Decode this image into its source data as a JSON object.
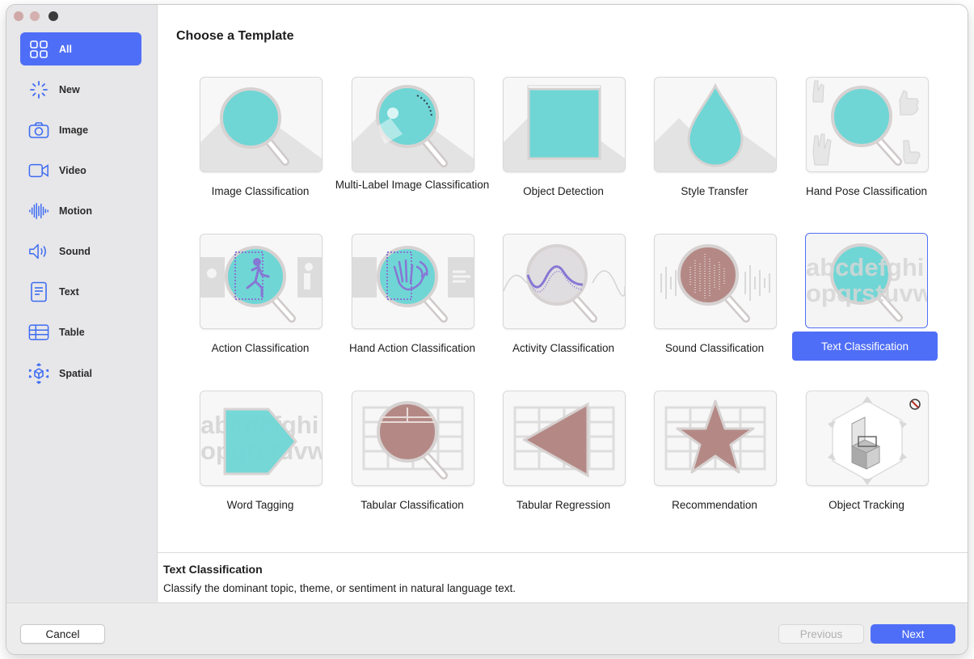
{
  "sidebar": {
    "items": [
      {
        "label": "All",
        "icon": "grid-icon",
        "active": true
      },
      {
        "label": "New",
        "icon": "sparkle-icon"
      },
      {
        "label": "Image",
        "icon": "camera-icon"
      },
      {
        "label": "Video",
        "icon": "video-camera-icon"
      },
      {
        "label": "Motion",
        "icon": "waveform-icon"
      },
      {
        "label": "Sound",
        "icon": "speaker-icon"
      },
      {
        "label": "Text",
        "icon": "document-icon"
      },
      {
        "label": "Table",
        "icon": "table-icon"
      },
      {
        "label": "Spatial",
        "icon": "spatial-cube-icon"
      }
    ]
  },
  "main": {
    "heading": "Choose a Template",
    "templates": [
      {
        "label": "Image Classification"
      },
      {
        "label": "Multi-Label Image Classification"
      },
      {
        "label": "Object Detection"
      },
      {
        "label": "Style Transfer"
      },
      {
        "label": "Hand Pose Classification"
      },
      {
        "label": "Action Classification"
      },
      {
        "label": "Hand Action Classification"
      },
      {
        "label": "Activity Classification"
      },
      {
        "label": "Sound Classification"
      },
      {
        "label": "Text Classification",
        "selected": true
      },
      {
        "label": "Word Tagging"
      },
      {
        "label": "Tabular Classification"
      },
      {
        "label": "Tabular Regression"
      },
      {
        "label": "Recommendation"
      },
      {
        "label": "Object Tracking"
      }
    ],
    "tile_text": {
      "top": "abcdefghi",
      "bottom": "opqrstuvw"
    }
  },
  "description": {
    "title": "Text Classification",
    "text": "Classify the dominant topic, theme, or sentiment in natural language text."
  },
  "footer": {
    "cancel": "Cancel",
    "previous": "Previous",
    "next": "Next"
  },
  "colors": {
    "accent": "#4f6ef7",
    "teal": "#72d6d6",
    "mauve": "#b48985",
    "purple": "#8677d4"
  }
}
